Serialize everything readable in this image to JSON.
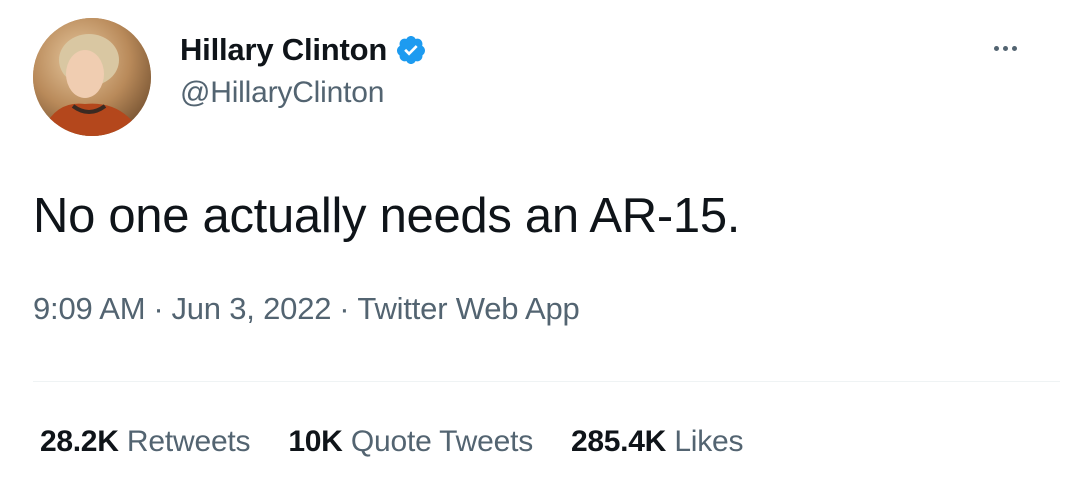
{
  "author": {
    "display_name": "Hillary Clinton",
    "handle": "@HillaryClinton",
    "verified": true,
    "verified_icon": "verified-badge-icon",
    "verified_color": "#1d9bf0"
  },
  "more_icon": "more-horizontal-icon",
  "tweet": {
    "text": "No one actually needs an AR-15."
  },
  "meta": {
    "time": "9:09 AM",
    "separator": "·",
    "date": "Jun 3, 2022",
    "source": "Twitter Web App"
  },
  "stats": [
    {
      "value": "28.2K",
      "label": "Retweets"
    },
    {
      "value": "10K",
      "label": "Quote Tweets"
    },
    {
      "value": "285.4K",
      "label": "Likes"
    }
  ],
  "colors": {
    "text_primary": "#0f1419",
    "text_secondary": "#536471",
    "divider": "#eff3f4"
  }
}
